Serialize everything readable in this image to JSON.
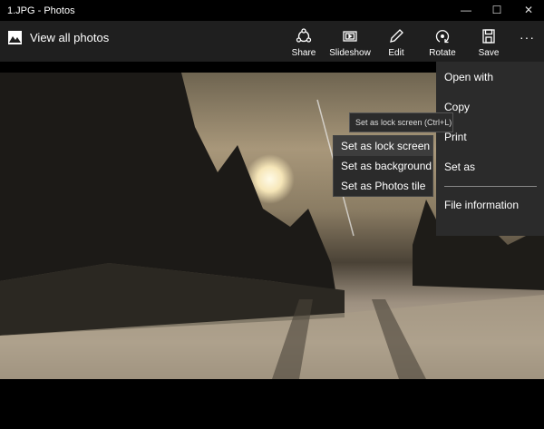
{
  "window": {
    "title": "1.JPG - Photos",
    "minimize": "—",
    "maximize": "☐",
    "close": "✕"
  },
  "toolbar": {
    "view_all": "View all photos",
    "share": "Share",
    "slideshow": "Slideshow",
    "edit": "Edit",
    "rotate": "Rotate",
    "save": "Save",
    "more": "···"
  },
  "menu": {
    "items": [
      "Open with",
      "Copy",
      "Print",
      "Set as",
      "File information"
    ]
  },
  "submenu": {
    "items": [
      "Set as lock screen",
      "Set as background",
      "Set as Photos tile"
    ]
  },
  "tooltip": "Set as lock screen (Ctrl+L)"
}
